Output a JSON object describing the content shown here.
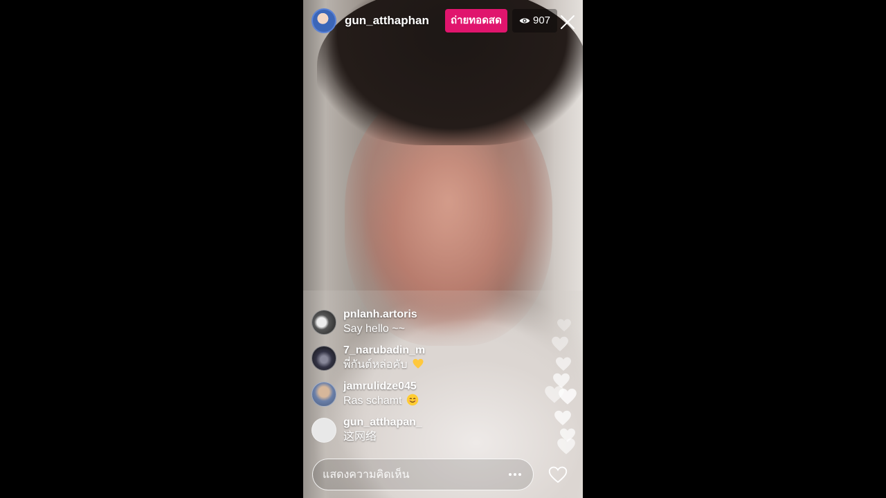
{
  "live": {
    "host_username": "gun_atthaphan",
    "live_label": "ถ่ายทอดสด",
    "viewer_count": "907"
  },
  "comments": [
    {
      "username": "pnlanh.artoris",
      "text": "Say hello ~~",
      "emoji": ""
    },
    {
      "username": "7_narubadin_m",
      "text": "พี่กันต์หล่อคับ",
      "emoji": "yellow-heart"
    },
    {
      "username": "jamrulidze045",
      "text": "Ras schamt",
      "emoji": "smiling-face"
    },
    {
      "username": "gun_atthapan_",
      "text": "这网络",
      "emoji": ""
    }
  ],
  "composer": {
    "placeholder": "แสดงความคิดเห็น"
  },
  "icons": {
    "viewer": "eye-icon",
    "close": "close-icon",
    "more": "more-dots-icon",
    "like": "heart-outline-icon"
  },
  "colors": {
    "live_badge": "#e0156d",
    "page_background": "#000000"
  }
}
